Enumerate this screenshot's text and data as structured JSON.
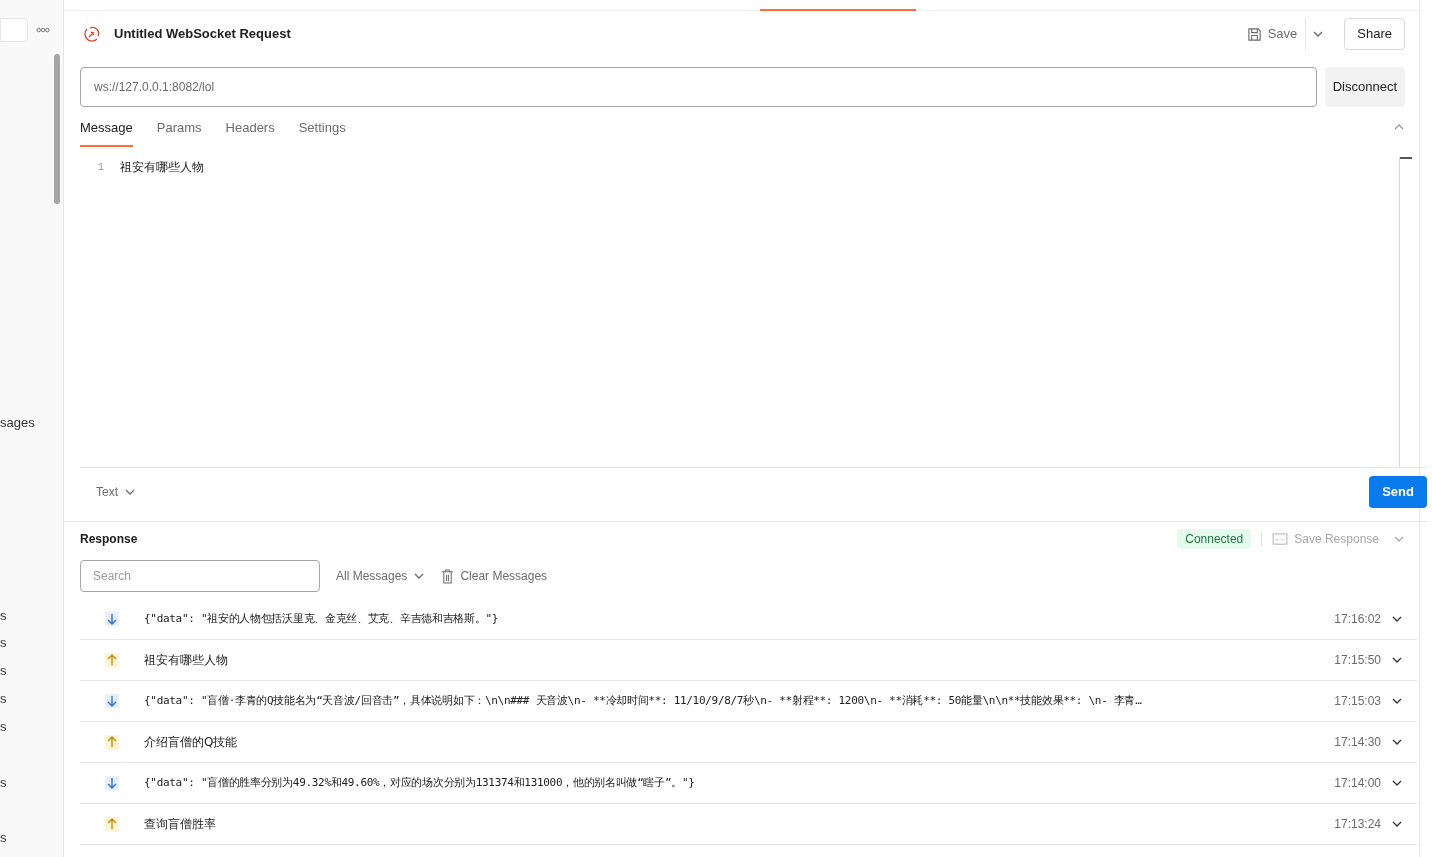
{
  "sidebar": {
    "fragments": [
      {
        "text": "sages"
      },
      {
        "text": "s"
      },
      {
        "text": "s"
      },
      {
        "text": "s"
      },
      {
        "text": "s"
      },
      {
        "text": "s"
      },
      {
        "text": "s"
      },
      {
        "text": "s"
      }
    ]
  },
  "request": {
    "title": "Untitled WebSocket Request",
    "save": "Save",
    "share": "Share",
    "url": "ws://127.0.0.1:8082/lol",
    "connect_button": "Disconnect"
  },
  "tabs": [
    {
      "label": "Message",
      "selected": true
    },
    {
      "label": "Params",
      "selected": false
    },
    {
      "label": "Headers",
      "selected": false
    },
    {
      "label": "Settings",
      "selected": false
    }
  ],
  "editor": {
    "lines": [
      {
        "number": "1",
        "text": "祖安有哪些人物"
      }
    ]
  },
  "message_format": "Text",
  "send": "Send",
  "response": {
    "title": "Response",
    "status": "Connected",
    "save_response": "Save Response",
    "search": {
      "placeholder": "Search"
    },
    "filter": "All Messages",
    "clear": "Clear Messages",
    "messages": [
      {
        "kind": "received",
        "text": "{\"data\": \"祖安的人物包括沃里克、金克丝、艾克、辛吉德和吉格斯。\"}",
        "time": "17:16:02"
      },
      {
        "kind": "sent",
        "text": "祖安有哪些人物",
        "time": "17:15:50"
      },
      {
        "kind": "received",
        "text": "{\"data\": \"盲僧·李青的Q技能名为“天音波/回音击”，具体说明如下：\\n\\n### 天音波\\n- **冷却时间**: 11/10/9/8/7秒\\n- **射程**: 1200\\n- **消耗**: 50能量\\n\\n**技能效果**: \\n- 李青…",
        "time": "17:15:03"
      },
      {
        "kind": "sent",
        "text": "介绍盲僧的Q技能",
        "time": "17:14:30"
      },
      {
        "kind": "received",
        "text": "{\"data\": \"盲僧的胜率分别为49.32%和49.60%，对应的场次分别为131374和131000，他的别名叫做“瞎子”。\"}",
        "time": "17:14:00"
      },
      {
        "kind": "sent",
        "text": "查询盲僧胜率",
        "time": "17:13:24"
      }
    ]
  }
}
